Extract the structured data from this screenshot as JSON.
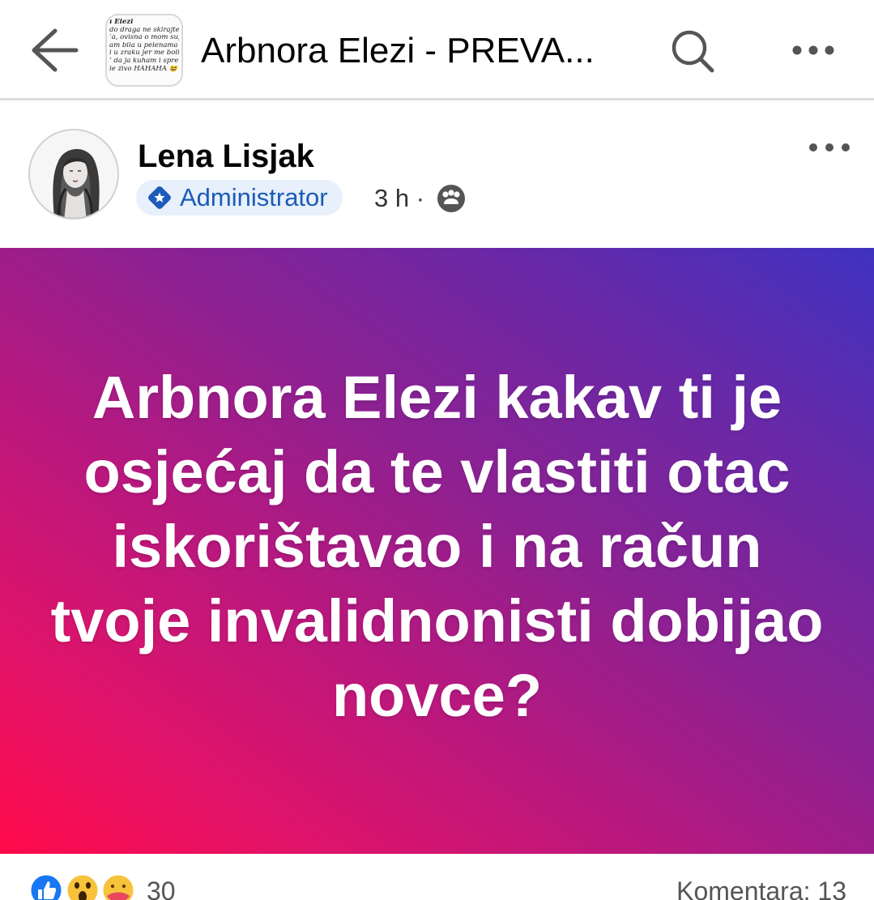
{
  "topbar": {
    "title": "Arbnora Elezi - PREVA...",
    "thumbnail_lines": [
      "ı Elezi",
      "do draga ne skirajte se",
      "ʼa, ovisna o mom supr",
      "am bila u pelenama do",
      "i u zraku jer me boli ku",
      "’ da ja kuham i spremi",
      "ie živo HAHAHA 😆"
    ]
  },
  "post": {
    "author": "Lena Lisjak",
    "role": "Administrator",
    "time": "3 h ·",
    "text": "Arbnora Elezi kakav ti je osjećaj da te vlastiti otac iskorištavao i na račun tvoje invalidnonisti dobijao novce?"
  },
  "reactions": {
    "count": "30",
    "comments": "Komentara: 13",
    "types": [
      "like-icon",
      "wow-icon",
      "care-icon"
    ]
  },
  "colors": {
    "accent": "#1877f2",
    "badge_bg": "#e7f0fb",
    "badge_text": "#1c5bb8",
    "gradient_start": "#ff0a4a",
    "gradient_end": "#3f32c0"
  }
}
